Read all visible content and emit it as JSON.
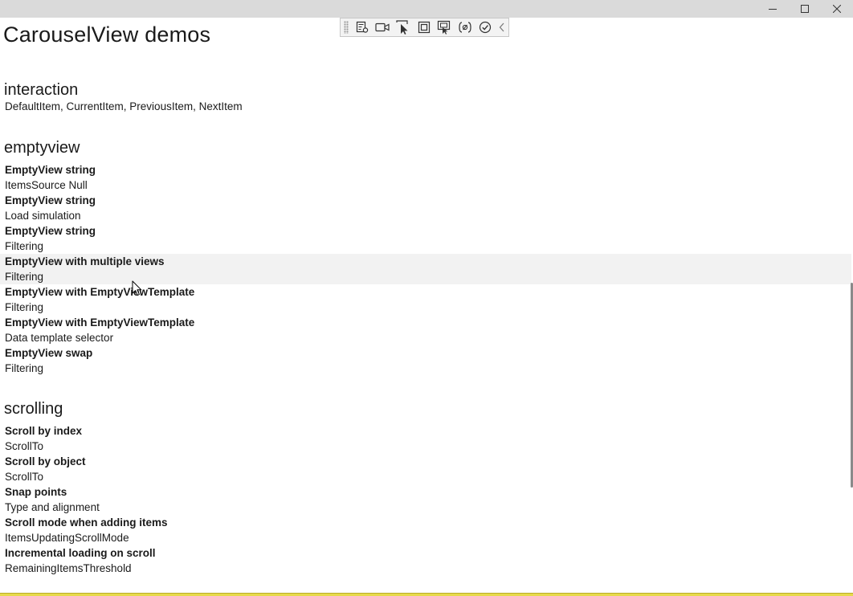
{
  "window": {
    "controls": [
      "minimize-icon",
      "maximize-icon",
      "close-icon"
    ]
  },
  "debug_toolbar": {
    "icons": [
      "live-visual-tree-icon",
      "camera-icon",
      "select-element-icon",
      "display-layout-adorners-icon",
      "track-focus-icon",
      "binding-failures-icon",
      "accessibility-check-icon",
      "collapse-toolbar-icon"
    ]
  },
  "page": {
    "title": "CarouselView demos"
  },
  "sections": [
    {
      "header": "interaction",
      "items": [
        {
          "title": "",
          "desc": "DefaultItem, CurrentItem, PreviousItem, NextItem"
        }
      ]
    },
    {
      "header": "emptyview",
      "items": [
        {
          "title": "EmptyView string",
          "desc": "ItemsSource Null"
        },
        {
          "title": "EmptyView string",
          "desc": "Load simulation"
        },
        {
          "title": "EmptyView string",
          "desc": "Filtering"
        },
        {
          "title": "EmptyView with multiple views",
          "desc": "Filtering"
        },
        {
          "title": "EmptyView with EmptyViewTemplate",
          "desc": "Filtering"
        },
        {
          "title": "EmptyView with EmptyViewTemplate",
          "desc": "Data template selector"
        },
        {
          "title": "EmptyView swap",
          "desc": "Filtering"
        }
      ]
    },
    {
      "header": "scrolling",
      "items": [
        {
          "title": "Scroll by index",
          "desc": "ScrollTo"
        },
        {
          "title": "Scroll by object",
          "desc": "ScrollTo"
        },
        {
          "title": "Snap points",
          "desc": "Type and alignment"
        },
        {
          "title": "Scroll mode when adding items",
          "desc": "ItemsUpdatingScrollMode"
        },
        {
          "title": "Incremental loading on scroll",
          "desc": "RemainingItemsThreshold"
        }
      ]
    }
  ],
  "colors": {
    "titlebar": "#dadada",
    "hover_row": "#f2f2f2",
    "accent_bottom": "#e6d94b"
  }
}
